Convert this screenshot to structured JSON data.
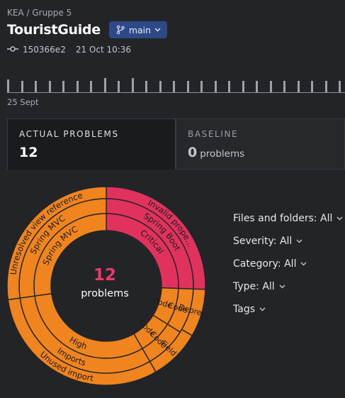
{
  "breadcrumb": "KEA / Gruppe 5",
  "project": {
    "title": "TouristGuide",
    "branch": "main",
    "commit_hash": "150366e2",
    "commit_date": "21 Oct 10:36"
  },
  "timeline": {
    "start_label": "25 Sept"
  },
  "tabs": [
    {
      "label": "ACTUAL PROBLEMS",
      "value": "12",
      "unit": ""
    },
    {
      "label": "BASELINE",
      "value": "0",
      "unit": "problems"
    }
  ],
  "chart": {
    "center_count": "12",
    "center_unit": "problems",
    "rings": {
      "inner": [
        {
          "label": "Critical",
          "color": "#e0325c"
        },
        {
          "label": "Code ...",
          "color": "#f0851f"
        },
        {
          "label": "Code ...",
          "color": "#f0851f"
        },
        {
          "label": "High",
          "color": "#f0851f"
        },
        {
          "label": "Spring MVC",
          "color": "#f0851f"
        }
      ],
      "middle": [
        {
          "label": "Spring Boot",
          "color": "#e0325c"
        },
        {
          "label": "Code ...",
          "color": "#f0851f"
        },
        {
          "label": "Code ...",
          "color": "#f0851f"
        },
        {
          "label": "Imports",
          "color": "#f0851f"
        },
        {
          "label": "Spring MVC",
          "color": "#f0851f"
        }
      ],
      "outer": [
        {
          "label": "Invalid prope...",
          "color": "#e0325c"
        },
        {
          "label": "Deprec...",
          "color": "#f0851f"
        },
        {
          "label": "Field ...",
          "color": "#f0851f"
        },
        {
          "label": "Unused import",
          "color": "#f0851f"
        },
        {
          "label": "Unresolved view reference",
          "color": "#f0851f"
        }
      ]
    }
  },
  "filters": [
    {
      "label": "Files and folders: All"
    },
    {
      "label": "Severity: All"
    },
    {
      "label": "Category: All"
    },
    {
      "label": "Type: All"
    },
    {
      "label": "Tags"
    }
  ],
  "icons": {
    "branch": "git-branch-icon",
    "commit": "git-commit-icon",
    "chevron": "chevron-down-icon"
  }
}
